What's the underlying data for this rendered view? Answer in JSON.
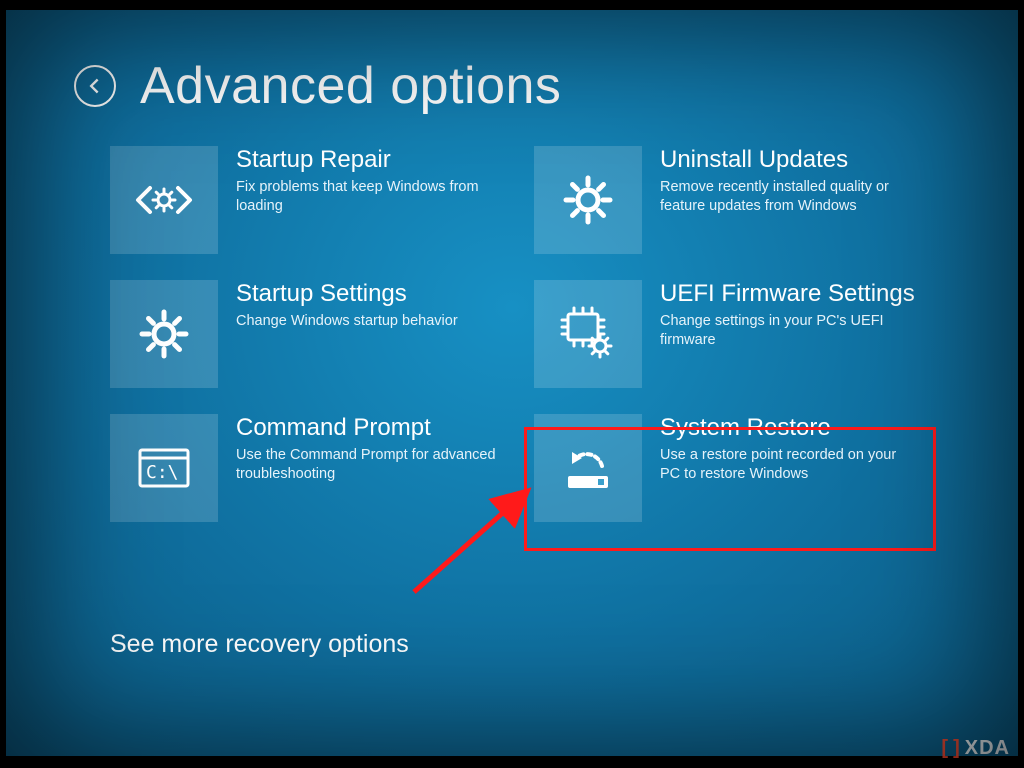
{
  "header": {
    "title": "Advanced options"
  },
  "tiles": {
    "startup_repair": {
      "title": "Startup Repair",
      "desc": "Fix problems that keep Windows from loading"
    },
    "uninstall_updates": {
      "title": "Uninstall Updates",
      "desc": "Remove recently installed quality or feature updates from Windows"
    },
    "startup_settings": {
      "title": "Startup Settings",
      "desc": "Change Windows startup behavior"
    },
    "uefi_firmware": {
      "title": "UEFI Firmware Settings",
      "desc": "Change settings in your PC's UEFI firmware"
    },
    "command_prompt": {
      "title": "Command Prompt",
      "desc": "Use the Command Prompt for advanced troubleshooting"
    },
    "system_restore": {
      "title": "System Restore",
      "desc": "Use a restore point recorded on your PC to restore Windows"
    }
  },
  "more_link": "See more recovery options",
  "watermark": {
    "text": "XDA"
  },
  "annotation": {
    "highlighted_tile": "system_restore",
    "colors": {
      "highlight": "#ff1a1a",
      "arrow": "#ff1a1a"
    }
  }
}
